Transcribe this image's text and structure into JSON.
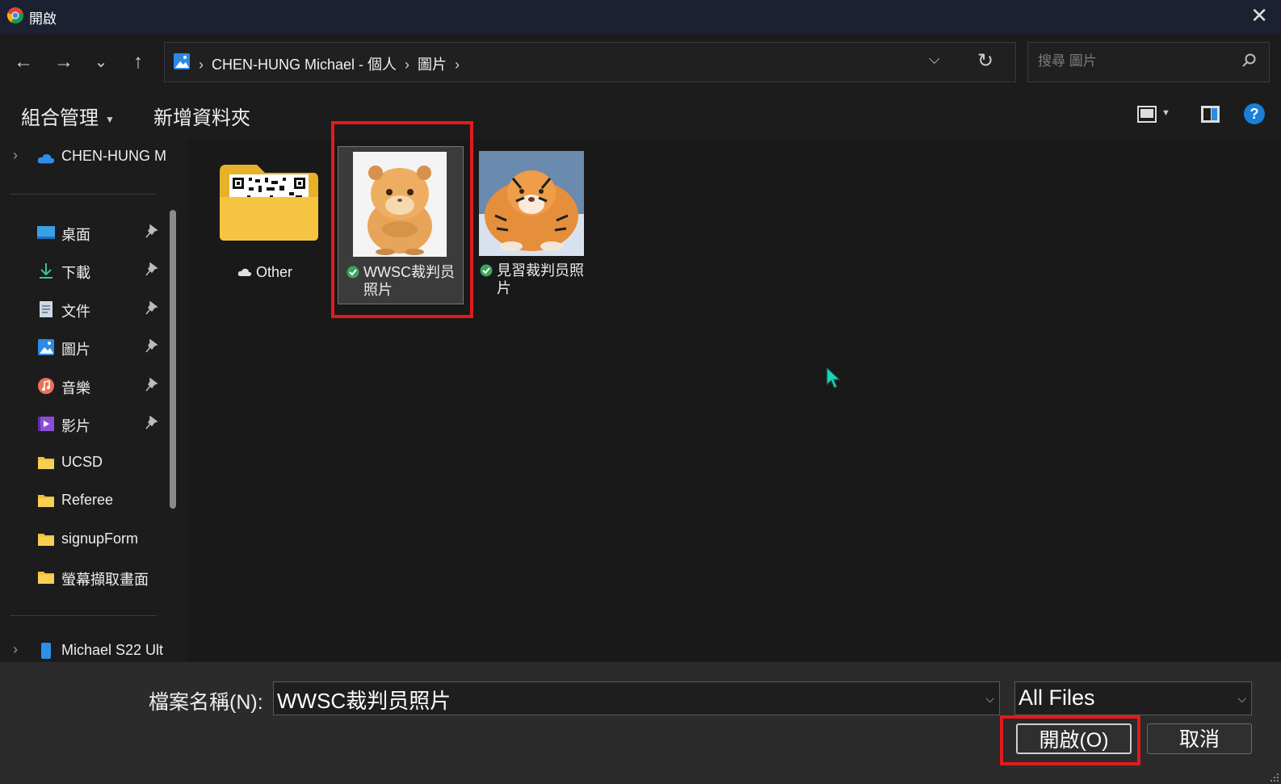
{
  "window": {
    "title": "開啟",
    "close_glyph": "✕"
  },
  "nav": {
    "back": "←",
    "forward": "→",
    "recent": "⌄",
    "up": "↑",
    "breadcrumbs": [
      "CHEN-HUNG Michael - 個人",
      "圖片"
    ],
    "breadcrumb_sep": "›",
    "dropdown_glyph": "⌵",
    "refresh_glyph": "↻",
    "search_placeholder": "搜尋 圖片"
  },
  "toolbar": {
    "organize": "組合管理",
    "new_folder": "新增資料夾",
    "help": "?"
  },
  "sidebar": {
    "onedrive": "CHEN-HUNG M",
    "quick_access": [
      {
        "label": "桌面",
        "icon": "desktop-icon"
      },
      {
        "label": "下載",
        "icon": "download-icon"
      },
      {
        "label": "文件",
        "icon": "documents-icon"
      },
      {
        "label": "圖片",
        "icon": "pictures-icon"
      },
      {
        "label": "音樂",
        "icon": "music-icon"
      },
      {
        "label": "影片",
        "icon": "video-icon"
      }
    ],
    "folders": [
      "UCSD",
      "Referee",
      "signupForm",
      "螢幕擷取畫面"
    ],
    "device": "Michael S22 Ult"
  },
  "files": [
    {
      "name": "Other",
      "type": "folder",
      "status": "cloud"
    },
    {
      "name": "WWSC裁判员照片",
      "line1": "WWSC裁判员",
      "line2": "照片",
      "type": "image",
      "status": "synced",
      "selected": true
    },
    {
      "name": "見習裁判员照片",
      "line1": "見習裁判员照",
      "line2": "片",
      "type": "image",
      "status": "synced"
    }
  ],
  "footer": {
    "filename_label": "檔案名稱(N):",
    "filename_value": "WWSC裁判员照片",
    "filetype": "All Files",
    "open_button": "開啟(O)",
    "cancel_button": "取消"
  },
  "colors": {
    "accent_red": "#e21b1b",
    "help_blue": "#1a7fd6",
    "titlebar": "#1b2130"
  }
}
